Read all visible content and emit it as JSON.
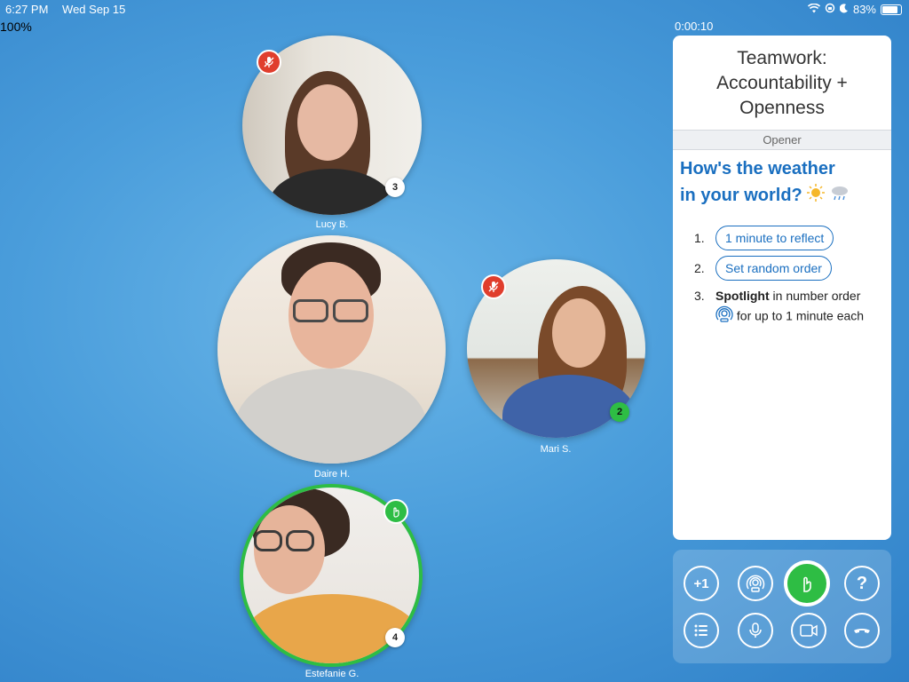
{
  "status": {
    "time": "6:27 PM",
    "date": "Wed Sep 15",
    "battery": "83%"
  },
  "zoom": "100%",
  "timer": "0:00:10",
  "participants": [
    {
      "name": "Lucy B.",
      "order": "3"
    },
    {
      "name": "Daire H."
    },
    {
      "name": "Mari S.",
      "order": "2"
    },
    {
      "name": "Estefanie G.",
      "order": "4"
    }
  ],
  "panel": {
    "title_line1": "Teamwork:",
    "title_line2": "Accountability +",
    "title_line3": "Openness",
    "section": "Opener",
    "prompt_line1": "How's the weather",
    "prompt_line2": "in your world?",
    "steps": {
      "one_num": "1.",
      "one_label": "1 minute to reflect",
      "two_num": "2.",
      "two_label": "Set random order",
      "three_num": "3.",
      "three_bold": "Spotlight",
      "three_rest": " in number order",
      "three_line2": "for up to 1 minute each"
    }
  },
  "controls": {
    "plus_one": "+1",
    "help": "?"
  },
  "colors": {
    "accent_blue": "#1a6fc0",
    "green": "#2ebd44",
    "mute_red": "#e03e2d"
  }
}
